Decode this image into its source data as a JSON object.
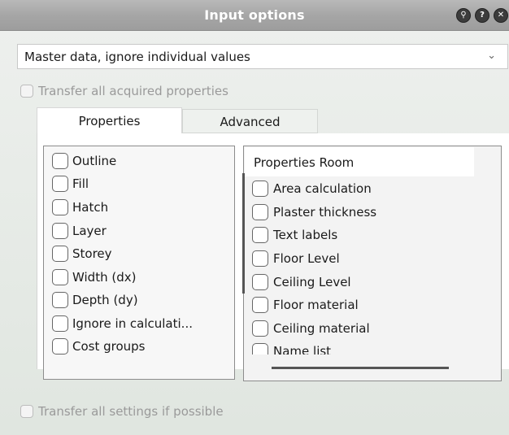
{
  "window": {
    "title": "Input options",
    "icons": [
      "pin-icon",
      "help-icon",
      "close-icon"
    ]
  },
  "input_mode": {
    "selected": "Master data, ignore individual values",
    "chevron": "⌄"
  },
  "transfer_all_acquired": {
    "label": "Transfer all acquired properties",
    "checked": false,
    "enabled": false
  },
  "tabs": [
    {
      "label": "Properties",
      "active": true
    },
    {
      "label": "Advanced",
      "active": false
    }
  ],
  "left_list": {
    "items": [
      {
        "label": "Outline",
        "checked": false
      },
      {
        "label": "Fill",
        "checked": false
      },
      {
        "label": "Hatch",
        "checked": false
      },
      {
        "label": "Layer",
        "checked": false
      },
      {
        "label": "Storey",
        "checked": false
      },
      {
        "label": "Width (dx)",
        "checked": false
      },
      {
        "label": "Depth (dy)",
        "checked": false
      },
      {
        "label": "Ignore in calculati...",
        "checked": false
      },
      {
        "label": "Cost groups",
        "checked": false
      }
    ]
  },
  "right_list": {
    "header": "Properties Room",
    "items": [
      {
        "label": "Area calculation",
        "checked": false
      },
      {
        "label": "Plaster thickness",
        "checked": false
      },
      {
        "label": "Text labels",
        "checked": false
      },
      {
        "label": "Floor Level",
        "checked": false
      },
      {
        "label": "Ceiling Level",
        "checked": false
      },
      {
        "label": "Floor material",
        "checked": false
      },
      {
        "label": "Ceiling material",
        "checked": false
      },
      {
        "label": "Name list",
        "checked": false
      }
    ]
  },
  "transfer_all_settings": {
    "label": "Transfer all settings if possible",
    "checked": false,
    "enabled": false
  },
  "colors": {
    "titlebar": "#a8a8a8",
    "background": "#e8ece8"
  }
}
